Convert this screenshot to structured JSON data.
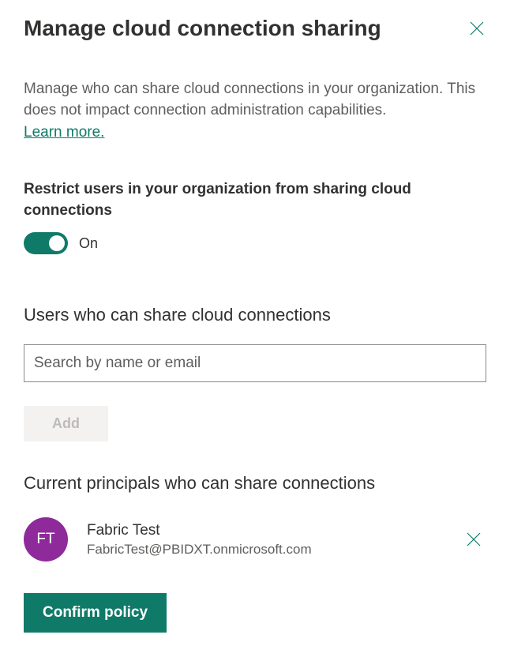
{
  "header": {
    "title": "Manage cloud connection sharing"
  },
  "description": "Manage who can share cloud connections in your organization. This does not impact connection administration capabilities.",
  "learn_more_label": "Learn more.",
  "restrict": {
    "label": "Restrict users in your organization from sharing cloud connections",
    "state": "On"
  },
  "users_section": {
    "title": "Users who can share cloud connections",
    "search_placeholder": "Search by name or email",
    "add_label": "Add"
  },
  "principals_section": {
    "title": "Current principals who can share connections",
    "items": [
      {
        "initials": "FT",
        "name": "Fabric Test",
        "email": "FabricTest@PBIDXT.onmicrosoft.com",
        "avatar_color": "#8e2a9a"
      }
    ]
  },
  "confirm_label": "Confirm policy"
}
